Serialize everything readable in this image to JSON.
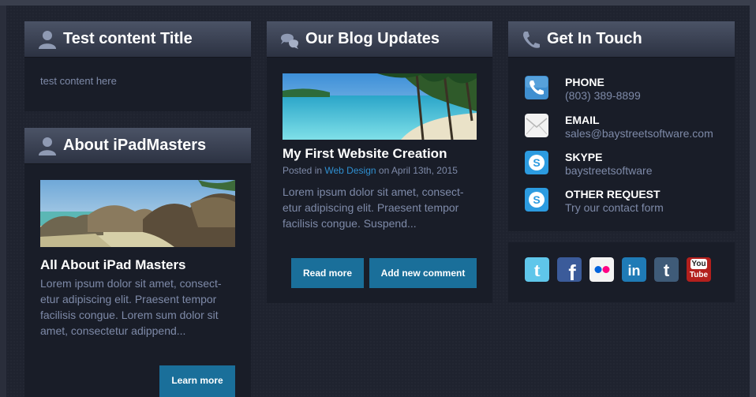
{
  "test_panel": {
    "title": "Test content Title",
    "title_icon": "user-icon",
    "body": "test content here"
  },
  "about_panel": {
    "title": "About iPadMasters",
    "title_icon": "user-icon",
    "heading": "All About iPad Masters",
    "body_lines": [
      "Lorem ipsum dolor sit amet, consect-",
      "etur adipiscing elit. Praesent tempor",
      "facilisis congue. Lorem sum dolor sit",
      "amet, consectetur adippend..."
    ],
    "button": "Learn more"
  },
  "blog_panel": {
    "title": "Our Blog Updates",
    "title_icon": "chat-bubbles-icon",
    "post_title": "My First Website Creation",
    "posted_in_prefix": "Posted in",
    "category": "Web Design",
    "date_text": "on April 13th, 2015",
    "body_lines": [
      "Lorem ipsum dolor sit amet, consect-",
      "etur adipiscing elit. Praesent tempor",
      "facilisis congue. Suspend..."
    ],
    "read_more": "Read more",
    "add_comment": "Add new comment"
  },
  "contact_panel": {
    "title": "Get In Touch",
    "title_icon": "phone-icon",
    "items": [
      {
        "label": "PHONE",
        "value": "(803) 389-8899",
        "icon": "phone-icon"
      },
      {
        "label": "EMAIL",
        "value": "sales@baystreetsoftware.com",
        "icon": "envelope-icon"
      },
      {
        "label": "SKYPE",
        "value": "baystreetsoftware",
        "icon": "skype-icon"
      },
      {
        "label": "OTHER REQUEST",
        "value": "Try our contact form",
        "icon": "skype-icon"
      }
    ]
  },
  "social": {
    "icons": [
      "twitter-icon",
      "facebook-icon",
      "flickr-icon",
      "linkedin-icon",
      "tumblr-icon",
      "youtube-icon"
    ],
    "youtube_you": "You",
    "youtube_tube": "Tube"
  },
  "colors": {
    "accent_button": "#1a6f9a",
    "link": "#2f8fd0",
    "body_text": "#7e8aa8"
  }
}
